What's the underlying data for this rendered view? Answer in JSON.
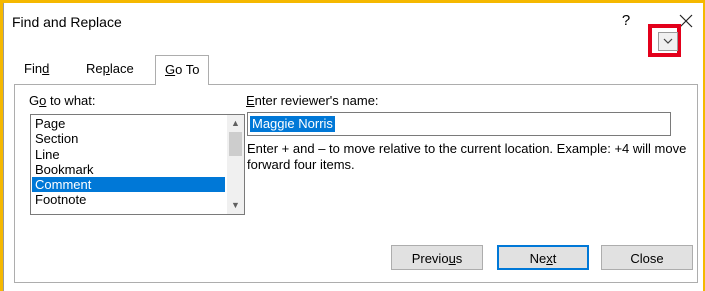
{
  "dialog": {
    "title": "Find and Replace",
    "help_symbol": "?",
    "close_icon": "close-icon"
  },
  "tabs": [
    {
      "label": "Find",
      "underline_char": "d",
      "active": false
    },
    {
      "label": "Replace",
      "underline_char": "p",
      "active": false
    },
    {
      "label": "Go To",
      "underline_char": "G",
      "active": true
    }
  ],
  "goto": {
    "label": "Go to what:",
    "items": [
      "Page",
      "Section",
      "Line",
      "Bookmark",
      "Comment",
      "Footnote"
    ],
    "selected": "Comment"
  },
  "reviewer": {
    "label": "Enter reviewer's name:",
    "value": "Maggie Norris",
    "dropdown_icon": "chevron-down-icon"
  },
  "help_text": "Enter + and – to move relative to the current location. Example: +4 will move forward four items.",
  "buttons": {
    "previous": "Previous",
    "next": "Next",
    "close": "Close"
  },
  "colors": {
    "highlight": "#e3001b",
    "selection": "#0078d7",
    "outer_border": "#f5b800"
  }
}
